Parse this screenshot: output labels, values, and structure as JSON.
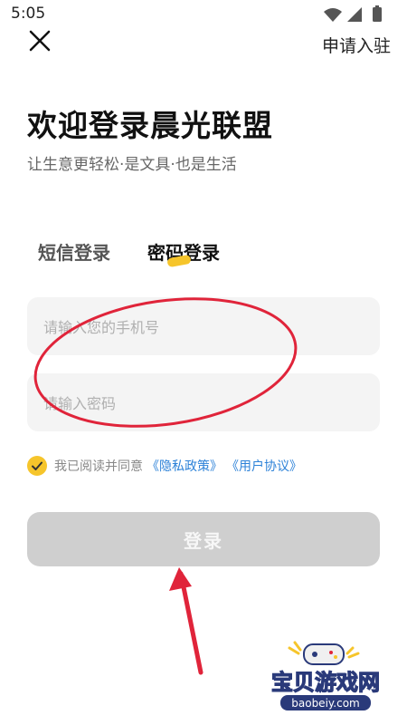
{
  "status_bar": {
    "time": "5:05",
    "icons": [
      "wifi-icon",
      "signal-icon",
      "battery-icon"
    ]
  },
  "header": {
    "close_icon": "close-icon",
    "join_label": "申请入驻"
  },
  "hero": {
    "title": "欢迎登录晨光联盟",
    "subtitle": "让生意更轻松·是文具·也是生活"
  },
  "tabs": [
    {
      "label": "短信登录",
      "active": false
    },
    {
      "label": "密码登录",
      "active": true
    }
  ],
  "form": {
    "phone_placeholder": "请输入您的手机号",
    "password_placeholder": "请输入密码"
  },
  "agreement": {
    "checked": true,
    "text": "我已阅读并同意",
    "privacy_link": "《隐私政策》",
    "terms_link": "《用户协议》"
  },
  "login_button": {
    "label": "登录"
  },
  "watermark": {
    "brand": "宝贝游戏网",
    "domain": "baobeiy.com"
  },
  "colors": {
    "accent": "#f6c52b",
    "link": "#2d82d8",
    "annotation": "#e0243a",
    "button_disabled": "#cfcfcf"
  }
}
